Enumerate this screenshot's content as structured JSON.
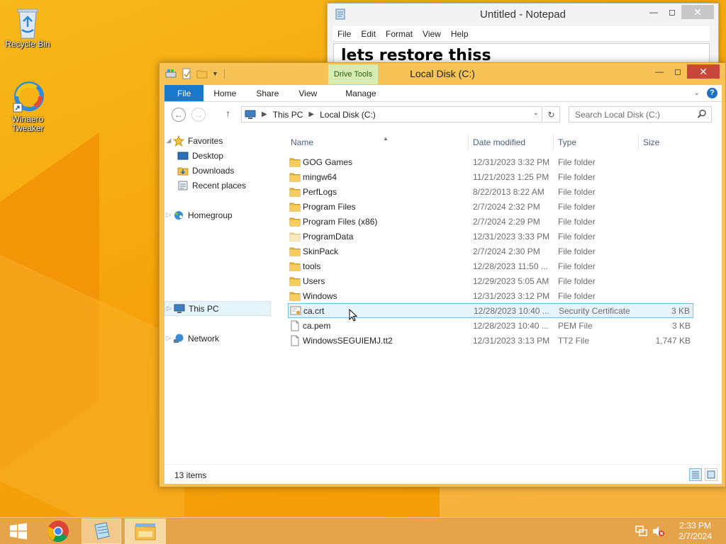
{
  "desktop": {
    "icons": [
      {
        "label": "Recycle Bin"
      },
      {
        "label": "Winaero Tweaker"
      }
    ]
  },
  "notepad": {
    "title": "Untitled - Notepad",
    "menu": [
      "File",
      "Edit",
      "Format",
      "View",
      "Help"
    ],
    "text": "lets restore thiss"
  },
  "explorer": {
    "title": "Local Disk (C:)",
    "contextual_tab": "Drive Tools",
    "tabs": [
      "File",
      "Home",
      "Share",
      "View",
      "Manage"
    ],
    "breadcrumb": [
      "This PC",
      "Local Disk (C:)"
    ],
    "search_placeholder": "Search Local Disk (C:)",
    "nav": {
      "favorites": "Favorites",
      "desktop": "Desktop",
      "downloads": "Downloads",
      "recent": "Recent places",
      "homegroup": "Homegroup",
      "thispc": "This PC",
      "network": "Network"
    },
    "columns": {
      "name": "Name",
      "date": "Date modified",
      "type": "Type",
      "size": "Size"
    },
    "files": [
      {
        "name": "GOG Games",
        "date": "12/31/2023 3:32 PM",
        "type": "File folder",
        "size": "",
        "kind": "folder"
      },
      {
        "name": "mingw64",
        "date": "11/21/2023 1:25 PM",
        "type": "File folder",
        "size": "",
        "kind": "folder"
      },
      {
        "name": "PerfLogs",
        "date": "8/22/2013 8:22 AM",
        "type": "File folder",
        "size": "",
        "kind": "folder"
      },
      {
        "name": "Program Files",
        "date": "2/7/2024 2:32 PM",
        "type": "File folder",
        "size": "",
        "kind": "folder"
      },
      {
        "name": "Program Files (x86)",
        "date": "2/7/2024 2:29 PM",
        "type": "File folder",
        "size": "",
        "kind": "folder"
      },
      {
        "name": "ProgramData",
        "date": "12/31/2023 3:33 PM",
        "type": "File folder",
        "size": "",
        "kind": "folder-light"
      },
      {
        "name": "SkinPack",
        "date": "2/7/2024 2:30 PM",
        "type": "File folder",
        "size": "",
        "kind": "folder"
      },
      {
        "name": "tools",
        "date": "12/28/2023 11:50 ...",
        "type": "File folder",
        "size": "",
        "kind": "folder"
      },
      {
        "name": "Users",
        "date": "12/29/2023 5:05 AM",
        "type": "File folder",
        "size": "",
        "kind": "folder"
      },
      {
        "name": "Windows",
        "date": "12/31/2023 3:12 PM",
        "type": "File folder",
        "size": "",
        "kind": "folder"
      },
      {
        "name": "ca.crt",
        "date": "12/28/2023 10:40 ...",
        "type": "Security Certificate",
        "size": "3 KB",
        "kind": "cert"
      },
      {
        "name": "ca.pem",
        "date": "12/28/2023 10:40 ...",
        "type": "PEM File",
        "size": "3 KB",
        "kind": "file"
      },
      {
        "name": "WindowsSEGUIEMJ.tt2",
        "date": "12/31/2023 3:13 PM",
        "type": "TT2 File",
        "size": "1,747 KB",
        "kind": "file"
      }
    ],
    "status": "13 items"
  },
  "taskbar": {
    "time": "2:33 PM",
    "date": "2/7/2024"
  },
  "colors": {
    "accent": "#1979ca",
    "window_frame": "#f7c356",
    "taskbar": "#e6a44a",
    "close_button": "#c9463d"
  }
}
